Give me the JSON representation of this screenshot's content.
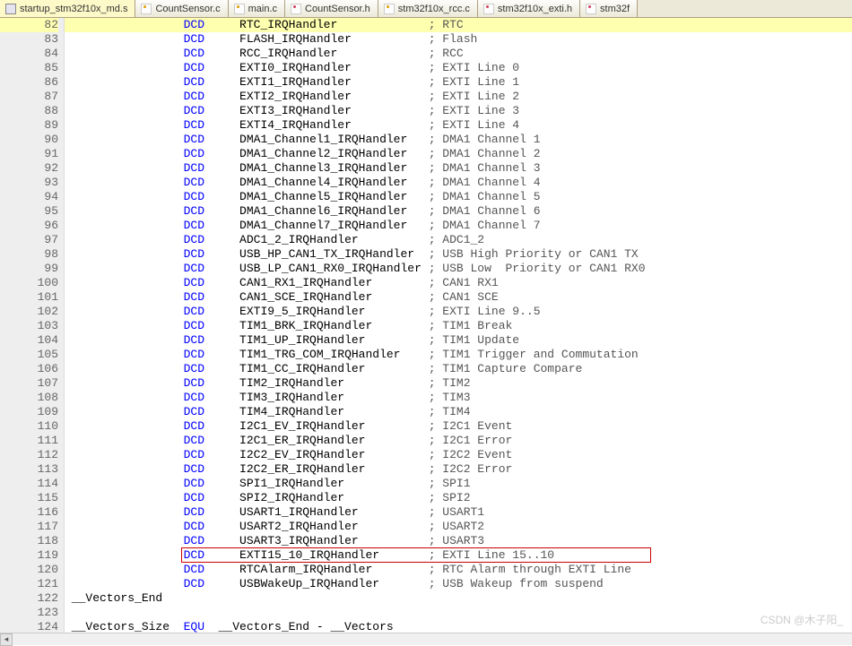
{
  "tabs": [
    {
      "label": "startup_stm32f10x_md.s",
      "icon": "asm",
      "active": true
    },
    {
      "label": "CountSensor.c",
      "icon": "c",
      "active": false
    },
    {
      "label": "main.c",
      "icon": "c",
      "active": false
    },
    {
      "label": "CountSensor.h",
      "icon": "h",
      "active": false
    },
    {
      "label": "stm32f10x_rcc.c",
      "icon": "c",
      "active": false
    },
    {
      "label": "stm32f10x_exti.h",
      "icon": "h",
      "active": false
    },
    {
      "label": "stm32f",
      "icon": "h",
      "active": false
    }
  ],
  "first_line": 82,
  "current_line": 82,
  "lines": [
    {
      "kw": "DCD",
      "handler": "RTC_IRQHandler",
      "comment": "; RTC"
    },
    {
      "kw": "DCD",
      "handler": "FLASH_IRQHandler",
      "comment": "; Flash"
    },
    {
      "kw": "DCD",
      "handler": "RCC_IRQHandler",
      "comment": "; RCC"
    },
    {
      "kw": "DCD",
      "handler": "EXTI0_IRQHandler",
      "comment": "; EXTI Line 0"
    },
    {
      "kw": "DCD",
      "handler": "EXTI1_IRQHandler",
      "comment": "; EXTI Line 1"
    },
    {
      "kw": "DCD",
      "handler": "EXTI2_IRQHandler",
      "comment": "; EXTI Line 2"
    },
    {
      "kw": "DCD",
      "handler": "EXTI3_IRQHandler",
      "comment": "; EXTI Line 3"
    },
    {
      "kw": "DCD",
      "handler": "EXTI4_IRQHandler",
      "comment": "; EXTI Line 4"
    },
    {
      "kw": "DCD",
      "handler": "DMA1_Channel1_IRQHandler",
      "comment": "; DMA1 Channel 1"
    },
    {
      "kw": "DCD",
      "handler": "DMA1_Channel2_IRQHandler",
      "comment": "; DMA1 Channel 2"
    },
    {
      "kw": "DCD",
      "handler": "DMA1_Channel3_IRQHandler",
      "comment": "; DMA1 Channel 3"
    },
    {
      "kw": "DCD",
      "handler": "DMA1_Channel4_IRQHandler",
      "comment": "; DMA1 Channel 4"
    },
    {
      "kw": "DCD",
      "handler": "DMA1_Channel5_IRQHandler",
      "comment": "; DMA1 Channel 5"
    },
    {
      "kw": "DCD",
      "handler": "DMA1_Channel6_IRQHandler",
      "comment": "; DMA1 Channel 6"
    },
    {
      "kw": "DCD",
      "handler": "DMA1_Channel7_IRQHandler",
      "comment": "; DMA1 Channel 7"
    },
    {
      "kw": "DCD",
      "handler": "ADC1_2_IRQHandler",
      "comment": "; ADC1_2"
    },
    {
      "kw": "DCD",
      "handler": "USB_HP_CAN1_TX_IRQHandler",
      "comment": "; USB High Priority or CAN1 TX"
    },
    {
      "kw": "DCD",
      "handler": "USB_LP_CAN1_RX0_IRQHandler ",
      "comment": "; USB Low  Priority or CAN1 RX0"
    },
    {
      "kw": "DCD",
      "handler": "CAN1_RX1_IRQHandler",
      "comment": "; CAN1 RX1"
    },
    {
      "kw": "DCD",
      "handler": "CAN1_SCE_IRQHandler",
      "comment": "; CAN1 SCE"
    },
    {
      "kw": "DCD",
      "handler": "EXTI9_5_IRQHandler",
      "comment": "; EXTI Line 9..5"
    },
    {
      "kw": "DCD",
      "handler": "TIM1_BRK_IRQHandler",
      "comment": "; TIM1 Break"
    },
    {
      "kw": "DCD",
      "handler": "TIM1_UP_IRQHandler",
      "comment": "; TIM1 Update"
    },
    {
      "kw": "DCD",
      "handler": "TIM1_TRG_COM_IRQHandler",
      "comment": "; TIM1 Trigger and Commutation"
    },
    {
      "kw": "DCD",
      "handler": "TIM1_CC_IRQHandler",
      "comment": "; TIM1 Capture Compare"
    },
    {
      "kw": "DCD",
      "handler": "TIM2_IRQHandler",
      "comment": "; TIM2"
    },
    {
      "kw": "DCD",
      "handler": "TIM3_IRQHandler",
      "comment": "; TIM3"
    },
    {
      "kw": "DCD",
      "handler": "TIM4_IRQHandler",
      "comment": "; TIM4"
    },
    {
      "kw": "DCD",
      "handler": "I2C1_EV_IRQHandler",
      "comment": "; I2C1 Event"
    },
    {
      "kw": "DCD",
      "handler": "I2C1_ER_IRQHandler",
      "comment": "; I2C1 Error"
    },
    {
      "kw": "DCD",
      "handler": "I2C2_EV_IRQHandler",
      "comment": "; I2C2 Event"
    },
    {
      "kw": "DCD",
      "handler": "I2C2_ER_IRQHandler",
      "comment": "; I2C2 Error"
    },
    {
      "kw": "DCD",
      "handler": "SPI1_IRQHandler",
      "comment": "; SPI1"
    },
    {
      "kw": "DCD",
      "handler": "SPI2_IRQHandler",
      "comment": "; SPI2"
    },
    {
      "kw": "DCD",
      "handler": "USART1_IRQHandler",
      "comment": "; USART1"
    },
    {
      "kw": "DCD",
      "handler": "USART2_IRQHandler",
      "comment": "; USART2"
    },
    {
      "kw": "DCD",
      "handler": "USART3_IRQHandler",
      "comment": "; USART3"
    },
    {
      "kw": "DCD",
      "handler": "EXTI15_10_IRQHandler",
      "comment": "; EXTI Line 15..10",
      "boxed": true
    },
    {
      "kw": "DCD",
      "handler": "RTCAlarm_IRQHandler",
      "comment": "; RTC Alarm through EXTI Line"
    },
    {
      "kw": "DCD",
      "handler": "USBWakeUp_IRQHandler",
      "comment": "; USB Wakeup from suspend"
    },
    {
      "raw": "__Vectors_End"
    },
    {
      "raw": ""
    },
    {
      "raw": "__Vectors_Size  EQU  __Vectors_End - __Vectors",
      "kw_inline": "EQU"
    }
  ],
  "indent": {
    "kw_col": 17,
    "handler_col": 5,
    "comment_col": 27
  },
  "watermark": "CSDN @木子阳_"
}
